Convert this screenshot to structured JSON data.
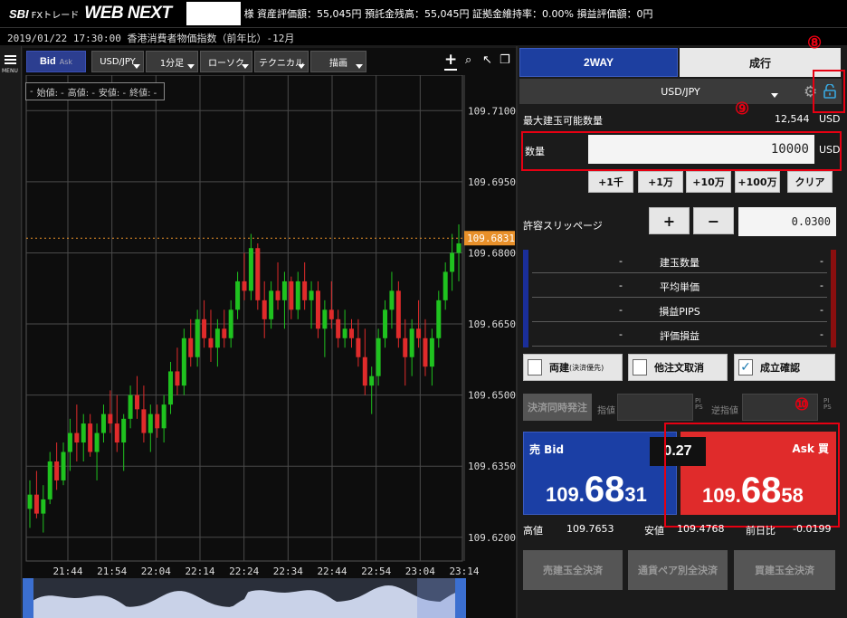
{
  "header": {
    "logo_sbi": "SBI",
    "logo_fx": "FXトレード",
    "logo_web": "WEB NEXT",
    "account_text": "様  資産評価額：55,045円   預託金残高：55,045円   証拠金維持率：0.00%   損益評価額：0円"
  },
  "subbar": {
    "text": "2019/01/22 17:30:00 香港消費者物価指数（前年比）-12月"
  },
  "menu": {
    "label": "MENU"
  },
  "chart_toolbar": {
    "bid": "Bid",
    "ask": "Ask",
    "pair": "USD/JPY",
    "interval": "1分足",
    "chart_type": "ローソク",
    "technical": "テクニカル",
    "draw": "描画"
  },
  "ohlc": {
    "open": "始値: -",
    "high": "高値: -",
    "low": "安値: -",
    "close": "終値: -",
    "lead": "-"
  },
  "chart_data": {
    "type": "candlestick",
    "y_ticks": [
      "109.7100",
      "109.6950",
      "109.6800",
      "109.6650",
      "109.6500",
      "109.6350",
      "109.6200"
    ],
    "y_tick_values": [
      109.71,
      109.695,
      109.68,
      109.665,
      109.65,
      109.635,
      109.62
    ],
    "x_ticks": [
      "21:44",
      "21:54",
      "22:04",
      "22:14",
      "22:24",
      "22:34",
      "22:44",
      "22:54",
      "23:04",
      "23:14"
    ],
    "current_price_label": "109.6831",
    "current_price": 109.6831,
    "ylim": [
      109.615,
      109.7175
    ],
    "up_color": "#1fc21f",
    "down_color": "#e02b2b",
    "candles": [
      [
        109.626,
        109.632,
        109.622,
        109.629
      ],
      [
        109.629,
        109.634,
        109.624,
        109.625
      ],
      [
        109.625,
        109.631,
        109.621,
        109.628
      ],
      [
        109.628,
        109.638,
        109.627,
        109.636
      ],
      [
        109.636,
        109.64,
        109.63,
        109.632
      ],
      [
        109.632,
        109.64,
        109.631,
        109.638
      ],
      [
        109.638,
        109.645,
        109.634,
        109.642
      ],
      [
        109.642,
        109.648,
        109.636,
        109.64
      ],
      [
        109.64,
        109.646,
        109.636,
        109.644
      ],
      [
        109.644,
        109.646,
        109.637,
        109.638
      ],
      [
        109.638,
        109.644,
        109.632,
        109.642
      ],
      [
        109.642,
        109.648,
        109.64,
        109.646
      ],
      [
        109.646,
        109.651,
        109.642,
        109.644
      ],
      [
        109.644,
        109.65,
        109.638,
        109.64
      ],
      [
        109.64,
        109.646,
        109.634,
        109.645
      ],
      [
        109.645,
        109.652,
        109.643,
        109.65
      ],
      [
        109.65,
        109.654,
        109.645,
        109.647
      ],
      [
        109.647,
        109.652,
        109.64,
        109.642
      ],
      [
        109.642,
        109.648,
        109.638,
        109.646
      ],
      [
        109.646,
        109.648,
        109.641,
        109.643
      ],
      [
        109.643,
        109.65,
        109.64,
        109.648
      ],
      [
        109.648,
        109.657,
        109.646,
        109.655
      ],
      [
        109.655,
        109.66,
        109.65,
        109.652
      ],
      [
        109.652,
        109.664,
        109.65,
        109.662
      ],
      [
        109.662,
        109.666,
        109.656,
        109.658
      ],
      [
        109.658,
        109.668,
        109.656,
        109.666
      ],
      [
        109.666,
        109.67,
        109.66,
        109.662
      ],
      [
        109.662,
        109.668,
        109.657,
        109.66
      ],
      [
        109.66,
        109.666,
        109.656,
        109.664
      ],
      [
        109.664,
        109.668,
        109.66,
        109.662
      ],
      [
        109.662,
        109.67,
        109.66,
        109.668
      ],
      [
        109.668,
        109.676,
        109.666,
        109.674
      ],
      [
        109.674,
        109.68,
        109.67,
        109.672
      ],
      [
        109.672,
        109.684,
        109.67,
        109.681
      ],
      [
        109.681,
        109.682,
        109.668,
        109.67
      ],
      [
        109.67,
        109.674,
        109.662,
        109.666
      ],
      [
        109.666,
        109.674,
        109.664,
        109.672
      ],
      [
        109.672,
        109.678,
        109.668,
        109.67
      ],
      [
        109.67,
        109.676,
        109.664,
        109.674
      ],
      [
        109.674,
        109.675,
        109.666,
        109.668
      ],
      [
        109.668,
        109.676,
        109.666,
        109.674
      ],
      [
        109.674,
        109.678,
        109.668,
        109.67
      ],
      [
        109.67,
        109.674,
        109.664,
        109.672
      ],
      [
        109.672,
        109.674,
        109.662,
        109.664
      ],
      [
        109.664,
        109.67,
        109.658,
        109.668
      ],
      [
        109.668,
        109.674,
        109.664,
        109.666
      ],
      [
        109.666,
        109.668,
        109.66,
        109.662
      ],
      [
        109.662,
        109.668,
        109.66,
        109.664
      ],
      [
        109.664,
        109.666,
        109.66,
        109.662
      ],
      [
        109.662,
        109.666,
        109.656,
        109.658
      ],
      [
        109.658,
        109.664,
        109.65,
        109.652
      ],
      [
        109.652,
        109.656,
        109.646,
        109.654
      ],
      [
        109.654,
        109.664,
        109.652,
        109.662
      ],
      [
        109.662,
        109.67,
        109.66,
        109.668
      ],
      [
        109.668,
        109.676,
        109.664,
        109.672
      ],
      [
        109.672,
        109.674,
        109.66,
        109.662
      ],
      [
        109.662,
        109.666,
        109.652,
        109.658
      ],
      [
        109.658,
        109.666,
        109.654,
        109.664
      ],
      [
        109.664,
        109.67,
        109.66,
        109.662
      ],
      [
        109.662,
        109.666,
        109.654,
        109.656
      ],
      [
        109.656,
        109.664,
        109.652,
        109.662
      ],
      [
        109.662,
        109.672,
        109.66,
        109.67
      ],
      [
        109.67,
        109.678,
        109.668,
        109.676
      ],
      [
        109.676,
        109.684,
        109.672,
        109.68
      ],
      [
        109.68,
        109.686,
        109.674,
        109.682
      ]
    ]
  },
  "panel": {
    "tab_2way": "2WAY",
    "tab_market": "成行",
    "pair": "USD/JPY",
    "max_qty_label": "最大建玉可能数量",
    "max_qty_value": "12,544",
    "usd": "USD",
    "qty_label": "数量",
    "qty_value": "10000",
    "qty_buttons": [
      "+1千",
      "+1万",
      "+10万",
      "+100万",
      "クリア"
    ],
    "slippage_label": "許容スリッページ",
    "plus": "+",
    "minus": "−",
    "slippage_value": "0.0300",
    "position_rows": [
      {
        "left": "-",
        "label": "建玉数量",
        "right": "-"
      },
      {
        "left": "-",
        "label": "平均単価",
        "right": "-"
      },
      {
        "left": "-",
        "label": "損益PIPS",
        "right": "-"
      },
      {
        "left": "-",
        "label": "評価損益",
        "right": "-"
      }
    ],
    "chk_ryodate": "両建",
    "chk_ryodate_sub": "(決済優先)",
    "chk_cancel": "他注文取消",
    "chk_confirm": "成立確認",
    "chk_mark": "✓",
    "settle_order": "決済同時発注",
    "limit_label": "指値",
    "stop_label": "逆指値",
    "pips_top": "PI",
    "pips_bottom": "PS",
    "sell_label": "売 Bid",
    "buy_label": "Ask 買",
    "bid_price": {
      "p1": "109.",
      "p2": "68",
      "p3": "31"
    },
    "ask_price": {
      "p1": "109.",
      "p2": "68",
      "p3": "58"
    },
    "spread": "0.27",
    "high_label": "高値",
    "high_value": "109.7653",
    "low_label": "安値",
    "low_value": "109.4768",
    "change_label": "前日比",
    "change_value": "-0.0199",
    "close_all_sell": "売建玉全決済",
    "close_all_pair": "通貨ペア別全決済",
    "close_all_buy": "買建玉全決済"
  },
  "annotations": {
    "n8": "⑧",
    "n9": "⑨",
    "n10": "⑩"
  },
  "colors": {
    "accent_red": "#e60012",
    "sell_blue": "#1b3fa5",
    "buy_red": "#e02b2b",
    "price_tag": "#e8902a"
  }
}
